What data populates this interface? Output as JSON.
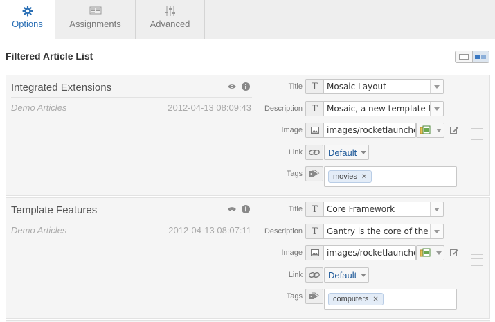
{
  "tabs": [
    {
      "label": "Options",
      "icon": "gear-icon",
      "active": true
    },
    {
      "label": "Assignments",
      "icon": "list-icon",
      "active": false
    },
    {
      "label": "Advanced",
      "icon": "sliders-icon",
      "active": false
    }
  ],
  "section": {
    "title": "Filtered Article List",
    "view_toggle": [
      "single-view-icon",
      "split-view-icon"
    ]
  },
  "field_labels": {
    "title": "Title",
    "description": "Description",
    "image": "Image",
    "link": "Link",
    "tags": "Tags"
  },
  "articles": [
    {
      "title": "Integrated Extensions",
      "category": "Demo Articles",
      "date": "2012-04-13 08:09:43",
      "field_title": "Mosaic Layout",
      "field_description": "Mosaic, a new template layo",
      "field_image": "images/rocketlauncher/",
      "field_link": "Default",
      "tags": [
        "movies"
      ]
    },
    {
      "title": "Template Features",
      "category": "Demo Articles",
      "date": "2012-04-13 08:07:11",
      "field_title": "Core Framework",
      "field_description": "Gantry is the core of the tem",
      "field_image": "images/rocketlauncher/",
      "field_link": "Default",
      "tags": [
        "computers"
      ]
    }
  ],
  "colors": {
    "accent": "#2a6fb5",
    "link_text": "#1f5a99",
    "tag_bg": "#e3ecf7",
    "row_bg": "#f5f5f5"
  }
}
